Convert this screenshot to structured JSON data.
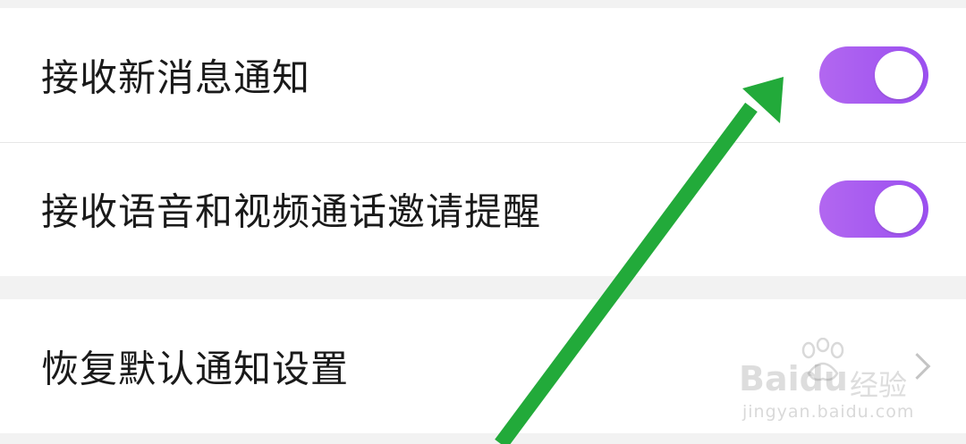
{
  "settings": {
    "rows": [
      {
        "label": "接收新消息通知",
        "toggle_on": true
      },
      {
        "label": "接收语音和视频通话邀请提醒",
        "toggle_on": true
      },
      {
        "label": "恢复默认通知设置"
      }
    ]
  },
  "watermark": {
    "brand": "Baidu",
    "brand_cn": "经验",
    "url": "jingyan.baidu.com"
  },
  "colors": {
    "toggle_on": "#a45bf0",
    "annotation_arrow": "#22aa3a",
    "background": "#f2f2f2"
  },
  "icons": {
    "row_3_trailing": "chevron-right-icon",
    "annotation": "green-arrow"
  }
}
